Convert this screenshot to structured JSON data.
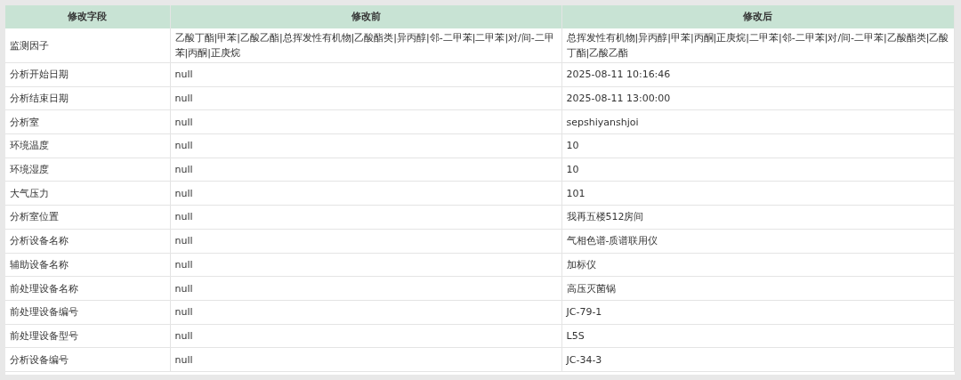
{
  "table": {
    "columns": [
      "修改字段",
      "修改前",
      "修改后"
    ],
    "rows": [
      [
        "监测因子",
        "乙酸丁酯|甲苯|乙酸乙酯|总挥发性有机物|乙酸酯类|异丙醇|邻-二甲苯|二甲苯|对/间-二甲苯|丙酮|正庚烷",
        "总挥发性有机物|异丙醇|甲苯|丙酮|正庚烷|二甲苯|邻-二甲苯|对/间-二甲苯|乙酸酯类|乙酸丁酯|乙酸乙酯"
      ],
      [
        "分析开始日期",
        "null",
        "2025-08-11 10:16:46"
      ],
      [
        "分析结束日期",
        "null",
        "2025-08-11 13:00:00"
      ],
      [
        "分析室",
        "null",
        "sepshiyanshjoi"
      ],
      [
        "环境温度",
        "null",
        "10"
      ],
      [
        "环境湿度",
        "null",
        "10"
      ],
      [
        "大气压力",
        "null",
        "101"
      ],
      [
        "分析室位置",
        "null",
        "我再五楼512房间"
      ],
      [
        "分析设备名称",
        "null",
        "气相色谱-质谱联用仪"
      ],
      [
        "辅助设备名称",
        "null",
        "加标仪"
      ],
      [
        "前处理设备名称",
        "null",
        "高压灭菌锅"
      ],
      [
        "前处理设备编号",
        "null",
        "JC-79-1"
      ],
      [
        "前处理设备型号",
        "null",
        "L5S"
      ],
      [
        "分析设备编号",
        "null",
        "JC-34-3"
      ]
    ]
  }
}
